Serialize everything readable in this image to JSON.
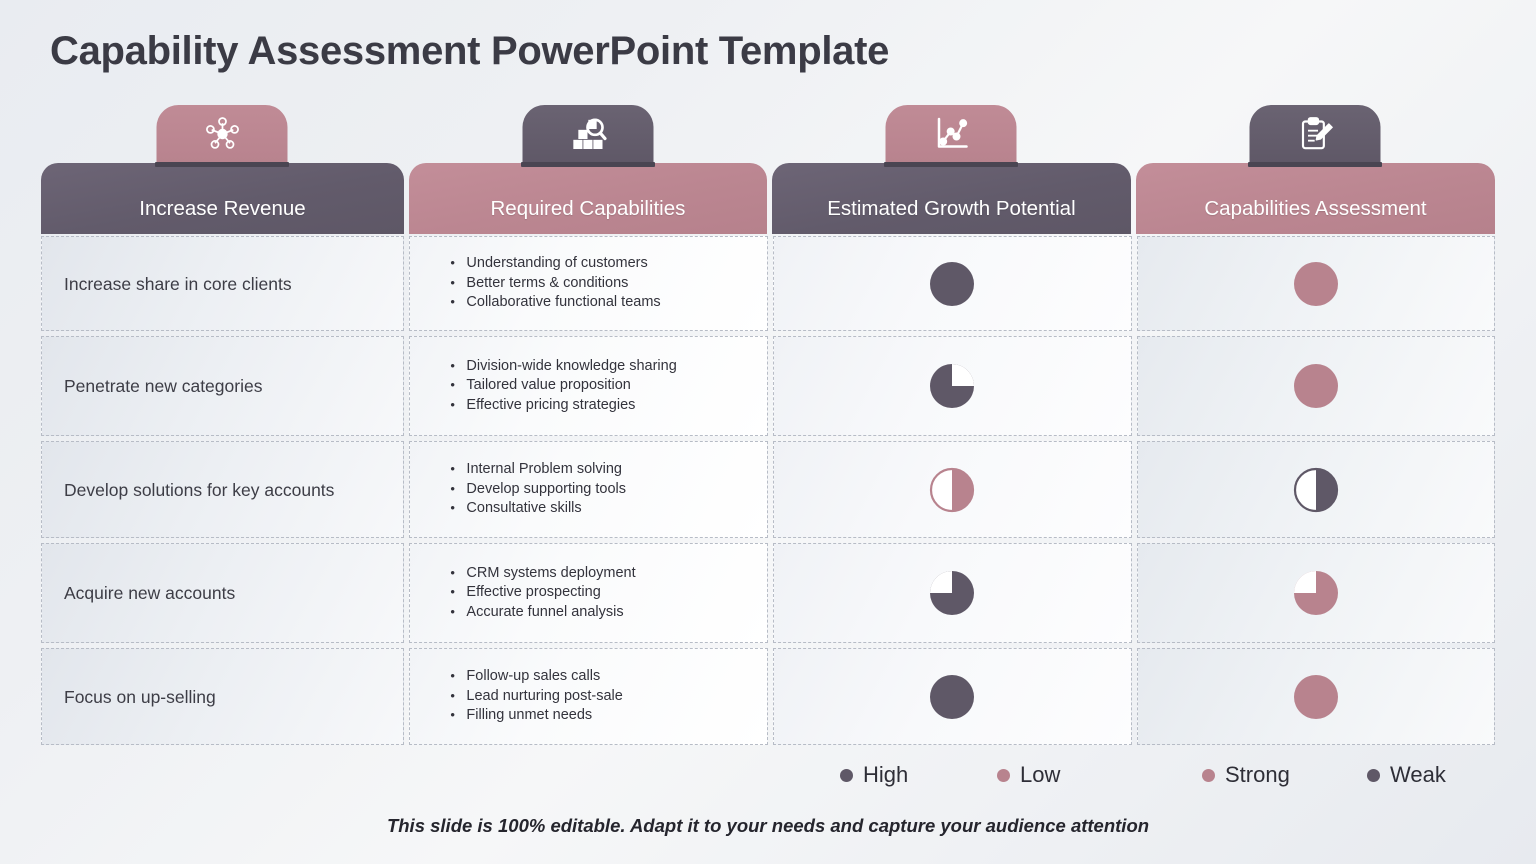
{
  "slide": {
    "title": "Capability Assessment PowerPoint Template",
    "footer": "This slide is 100% editable. Adapt it to your needs and capture your audience attention"
  },
  "colors": {
    "dark": "#5f5867",
    "rose": "#b8838e",
    "header_dark": "#625b6b",
    "header_rose": "#bb8691",
    "cell_border": "#b7bcc6",
    "text": "#3d3d46"
  },
  "columns": [
    {
      "label": "Increase Revenue",
      "icon": "network-hub-icon",
      "header_style": "dark",
      "cap_style": "rose"
    },
    {
      "label": "Required Capabilities",
      "icon": "boxes-search-icon",
      "header_style": "rose",
      "cap_style": "dark"
    },
    {
      "label": "Estimated Growth Potential",
      "icon": "line-chart-icon",
      "header_style": "dark",
      "cap_style": "rose"
    },
    {
      "label": "Capabilities Assessment",
      "icon": "clipboard-pencil-icon",
      "header_style": "rose",
      "cap_style": "dark"
    }
  ],
  "rows": [
    {
      "objective": "Increase share in core clients",
      "capabilities": [
        "Understanding  of customers",
        "Better terms & conditions",
        "Collaborative functional  teams"
      ],
      "growth_potential": {
        "fill": 100,
        "color": "dark",
        "label": "High"
      },
      "capability_assessment": {
        "fill": 100,
        "color": "rose",
        "label": "Strong"
      }
    },
    {
      "objective": "Penetrate new categories",
      "capabilities": [
        "Division-wide knowledge sharing",
        "Tailored value  proposition",
        "Effective pricing strategies"
      ],
      "growth_potential": {
        "fill": 75,
        "color": "dark",
        "empty_quadrant": "top-right",
        "label": "High"
      },
      "capability_assessment": {
        "fill": 100,
        "color": "rose",
        "label": "Strong"
      }
    },
    {
      "objective": "Develop solutions for key accounts",
      "capabilities": [
        "Internal  Problem solving",
        "Develop supporting tools",
        "Consultative  skills"
      ],
      "growth_potential": {
        "fill": 50,
        "color": "rose",
        "empty_half": "left",
        "label": "Low"
      },
      "capability_assessment": {
        "fill": 50,
        "color": "dark",
        "empty_half": "left",
        "label": "Weak"
      }
    },
    {
      "objective": "Acquire new accounts",
      "capabilities": [
        "CRM systems deployment",
        "Effective prospecting",
        "Accurate funnel  analysis"
      ],
      "growth_potential": {
        "fill": 75,
        "color": "dark",
        "empty_quadrant": "top-left",
        "label": "High"
      },
      "capability_assessment": {
        "fill": 75,
        "color": "rose",
        "empty_quadrant": "top-left",
        "label": "Strong"
      }
    },
    {
      "objective": "Focus on up-selling",
      "capabilities": [
        "Follow-up sales calls",
        "Lead nurturing  post-sale",
        "Filling unmet  needs"
      ],
      "growth_potential": {
        "fill": 100,
        "color": "dark",
        "label": "High"
      },
      "capability_assessment": {
        "fill": 100,
        "color": "rose",
        "label": "Strong"
      }
    }
  ],
  "legend": [
    {
      "label": "High",
      "color": "dark"
    },
    {
      "label": "Low",
      "color": "rose"
    },
    {
      "label": "Strong",
      "color": "rose"
    },
    {
      "label": "Weak",
      "color": "dark"
    }
  ]
}
